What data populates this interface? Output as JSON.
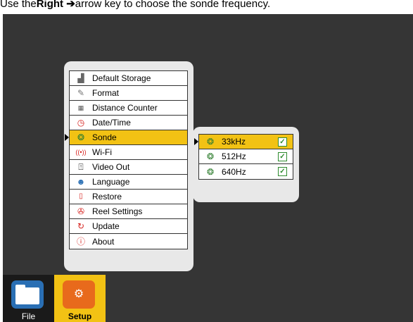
{
  "instruction": {
    "prefix": "Use the ",
    "bold": "Right",
    "arrow": "➔",
    "suffix": " arrow key to choose the sonde frequency."
  },
  "main_menu": {
    "selected_index": 4,
    "items": [
      {
        "label": "Default Storage",
        "icon": "storage-icon"
      },
      {
        "label": "Format",
        "icon": "format-icon"
      },
      {
        "label": "Distance Counter",
        "icon": "distance-counter-icon"
      },
      {
        "label": "Date/Time",
        "icon": "clock-icon"
      },
      {
        "label": "Sonde",
        "icon": "sonde-icon"
      },
      {
        "label": "Wi-Fi",
        "icon": "wifi-icon"
      },
      {
        "label": "Video Out",
        "icon": "video-out-icon"
      },
      {
        "label": "Language",
        "icon": "language-icon"
      },
      {
        "label": "Restore",
        "icon": "restore-icon"
      },
      {
        "label": "Reel Settings",
        "icon": "reel-icon"
      },
      {
        "label": "Update",
        "icon": "update-icon"
      },
      {
        "label": "About",
        "icon": "info-icon"
      }
    ]
  },
  "sonde_menu": {
    "selected_index": 0,
    "items": [
      {
        "label": "33kHz",
        "icon": "sonde-icon",
        "checked": true
      },
      {
        "label": "512Hz",
        "icon": "sonde-icon",
        "checked": true
      },
      {
        "label": "640Hz",
        "icon": "sonde-icon",
        "checked": true
      }
    ]
  },
  "bottom_tabs": {
    "file_label": "File",
    "setup_label": "Setup",
    "file_icon": "folder-icon",
    "setup_icon": "gears-icon"
  },
  "colors": {
    "screen_bg": "#353535",
    "highlight": "#f2c214",
    "panel": "#e8e8e8",
    "file_icon": "#2a6fb4",
    "setup_icon": "#e86a1c"
  }
}
